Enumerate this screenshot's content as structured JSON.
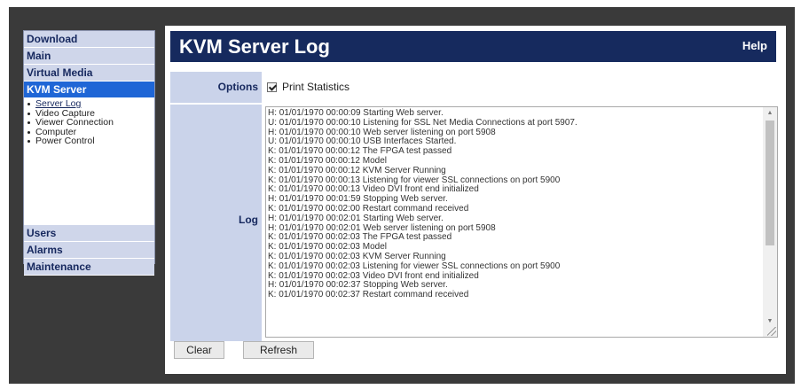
{
  "sidebar": {
    "items_top": [
      {
        "label": "Download"
      },
      {
        "label": "Main"
      },
      {
        "label": "Virtual Media"
      },
      {
        "label": "KVM Server",
        "active": true
      }
    ],
    "submenu": [
      {
        "label": "Server Log"
      },
      {
        "label": "Video Capture"
      },
      {
        "label": "Viewer Connection"
      },
      {
        "label": "Computer"
      },
      {
        "label": "Power Control"
      }
    ],
    "items_bottom": [
      {
        "label": "Users"
      },
      {
        "label": "Alarms"
      },
      {
        "label": "Maintenance"
      }
    ]
  },
  "header": {
    "title": "KVM Server Log",
    "help": "Help"
  },
  "options": {
    "label": "Options",
    "print_statistics_label": "Print Statistics",
    "print_statistics_checked": true
  },
  "log": {
    "label": "Log",
    "lines": [
      "H: 01/01/1970 00:00:09 Starting Web server.",
      "U: 01/01/1970 00:00:10 Listening for SSL Net Media Connections at port 5907.",
      "H: 01/01/1970 00:00:10 Web server listening on port 5908",
      "U: 01/01/1970 00:00:10 USB Interfaces Started.",
      "K: 01/01/1970 00:00:12 The FPGA test passed",
      "K: 01/01/1970 00:00:12 Model",
      "K: 01/01/1970 00:00:12 KVM Server Running",
      "K: 01/01/1970 00:00:13 Listening for viewer SSL connections on port 5900",
      "K: 01/01/1970 00:00:13 Video DVI front end initialized",
      "H: 01/01/1970 00:01:59 Stopping Web server.",
      "K: 01/01/1970 00:02:00 Restart command received",
      "H: 01/01/1970 00:02:01 Starting Web server.",
      "H: 01/01/1970 00:02:01 Web server listening on port 5908",
      "K: 01/01/1970 00:02:03 The FPGA test passed",
      "K: 01/01/1970 00:02:03 Model",
      "K: 01/01/1970 00:02:03 KVM Server Running",
      "K: 01/01/1970 00:02:03 Listening for viewer SSL connections on port 5900",
      "K: 01/01/1970 00:02:03 Video DVI front end initialized",
      "H: 01/01/1970 00:02:37 Stopping Web server.",
      "K: 01/01/1970 00:02:37 Restart command received"
    ]
  },
  "buttons": {
    "clear": "Clear",
    "refresh": "Refresh"
  },
  "colors": {
    "header_bg": "#162a5e",
    "nav_bg": "#cfd6ea",
    "nav_active": "#1f66d6",
    "label_col_bg": "#cad3ea"
  }
}
